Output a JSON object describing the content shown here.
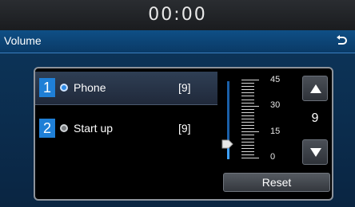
{
  "status_bar": {
    "clock": "00:00"
  },
  "title_bar": {
    "title": "Volume"
  },
  "list": {
    "items": [
      {
        "number": "1",
        "label": "Phone",
        "value": "[9]",
        "selected": true
      },
      {
        "number": "2",
        "label": "Start up",
        "value": "[9]",
        "selected": false
      }
    ]
  },
  "volume_control": {
    "current_value": "9",
    "level": 9,
    "max": 45,
    "scale_labels": [
      "45",
      "30",
      "15",
      "0"
    ],
    "reset_label": "Reset"
  },
  "colors": {
    "accent": "#1f7fd6",
    "title_bar": "#0f4f86",
    "panel_border": "#8d939b"
  },
  "icons": {
    "back": "back-arrow-icon",
    "up": "triangle-up-icon",
    "down": "triangle-down-icon"
  }
}
